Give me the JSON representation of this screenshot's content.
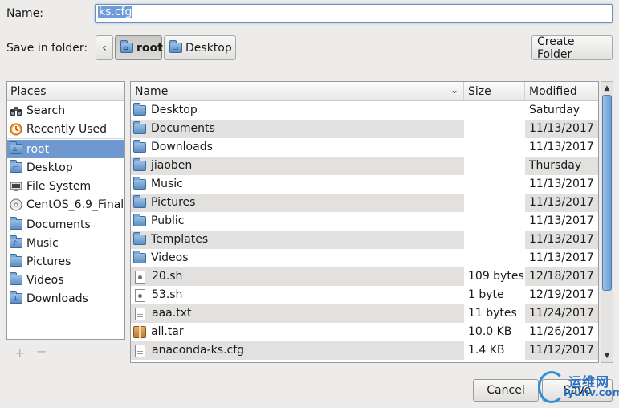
{
  "name_row": {
    "label": "Name:",
    "value": "ks.cfg"
  },
  "folder_row": {
    "label": "Save in folder:",
    "back_glyph": "‹",
    "path": [
      "root",
      "Desktop"
    ],
    "create_folder": "Create Folder"
  },
  "places": {
    "header": "Places",
    "items": [
      {
        "label": "Search",
        "icon": "binoculars-icon"
      },
      {
        "label": "Recently Used",
        "icon": "clock-icon"
      },
      {
        "label": "root",
        "icon": "home-folder-icon",
        "selected": true
      },
      {
        "label": "Desktop",
        "icon": "desktop-folder-icon"
      },
      {
        "label": "File System",
        "icon": "harddrive-icon"
      },
      {
        "label": "CentOS_6.9_Final",
        "icon": "disc-icon"
      },
      {
        "label": "Documents",
        "icon": "folder-icon"
      },
      {
        "label": "Music",
        "icon": "folder-icon"
      },
      {
        "label": "Pictures",
        "icon": "folder-icon"
      },
      {
        "label": "Videos",
        "icon": "folder-icon"
      },
      {
        "label": "Downloads",
        "icon": "folder-icon"
      }
    ],
    "add_glyph": "+",
    "remove_glyph": "−"
  },
  "files": {
    "columns": {
      "name": "Name",
      "size": "Size",
      "modified": "Modified"
    },
    "rows": [
      {
        "name": "Desktop",
        "size": "",
        "modified": "Saturday",
        "type": "folder"
      },
      {
        "name": "Documents",
        "size": "",
        "modified": "11/13/2017",
        "type": "folder"
      },
      {
        "name": "Downloads",
        "size": "",
        "modified": "11/13/2017",
        "type": "folder"
      },
      {
        "name": "jiaoben",
        "size": "",
        "modified": "Thursday",
        "type": "folder"
      },
      {
        "name": "Music",
        "size": "",
        "modified": "11/13/2017",
        "type": "folder"
      },
      {
        "name": "Pictures",
        "size": "",
        "modified": "11/13/2017",
        "type": "folder"
      },
      {
        "name": "Public",
        "size": "",
        "modified": "11/13/2017",
        "type": "folder"
      },
      {
        "name": "Templates",
        "size": "",
        "modified": "11/13/2017",
        "type": "folder"
      },
      {
        "name": "Videos",
        "size": "",
        "modified": "11/13/2017",
        "type": "folder"
      },
      {
        "name": "20.sh",
        "size": "109 bytes",
        "modified": "12/18/2017",
        "type": "script"
      },
      {
        "name": "53.sh",
        "size": "1 byte",
        "modified": "12/19/2017",
        "type": "script"
      },
      {
        "name": "aaa.txt",
        "size": "11 bytes",
        "modified": "11/24/2017",
        "type": "text"
      },
      {
        "name": "all.tar",
        "size": "10.0 KB",
        "modified": "11/26/2017",
        "type": "archive"
      },
      {
        "name": "anaconda-ks.cfg",
        "size": "1.4 KB",
        "modified": "11/12/2017",
        "type": "text"
      }
    ]
  },
  "buttons": {
    "cancel": "Cancel",
    "save": "Save"
  },
  "watermark": {
    "line1": "运维网",
    "line2": "iyunv.com"
  },
  "colors": {
    "selection": "#6e98cf",
    "accent": "#2b6fc0"
  }
}
